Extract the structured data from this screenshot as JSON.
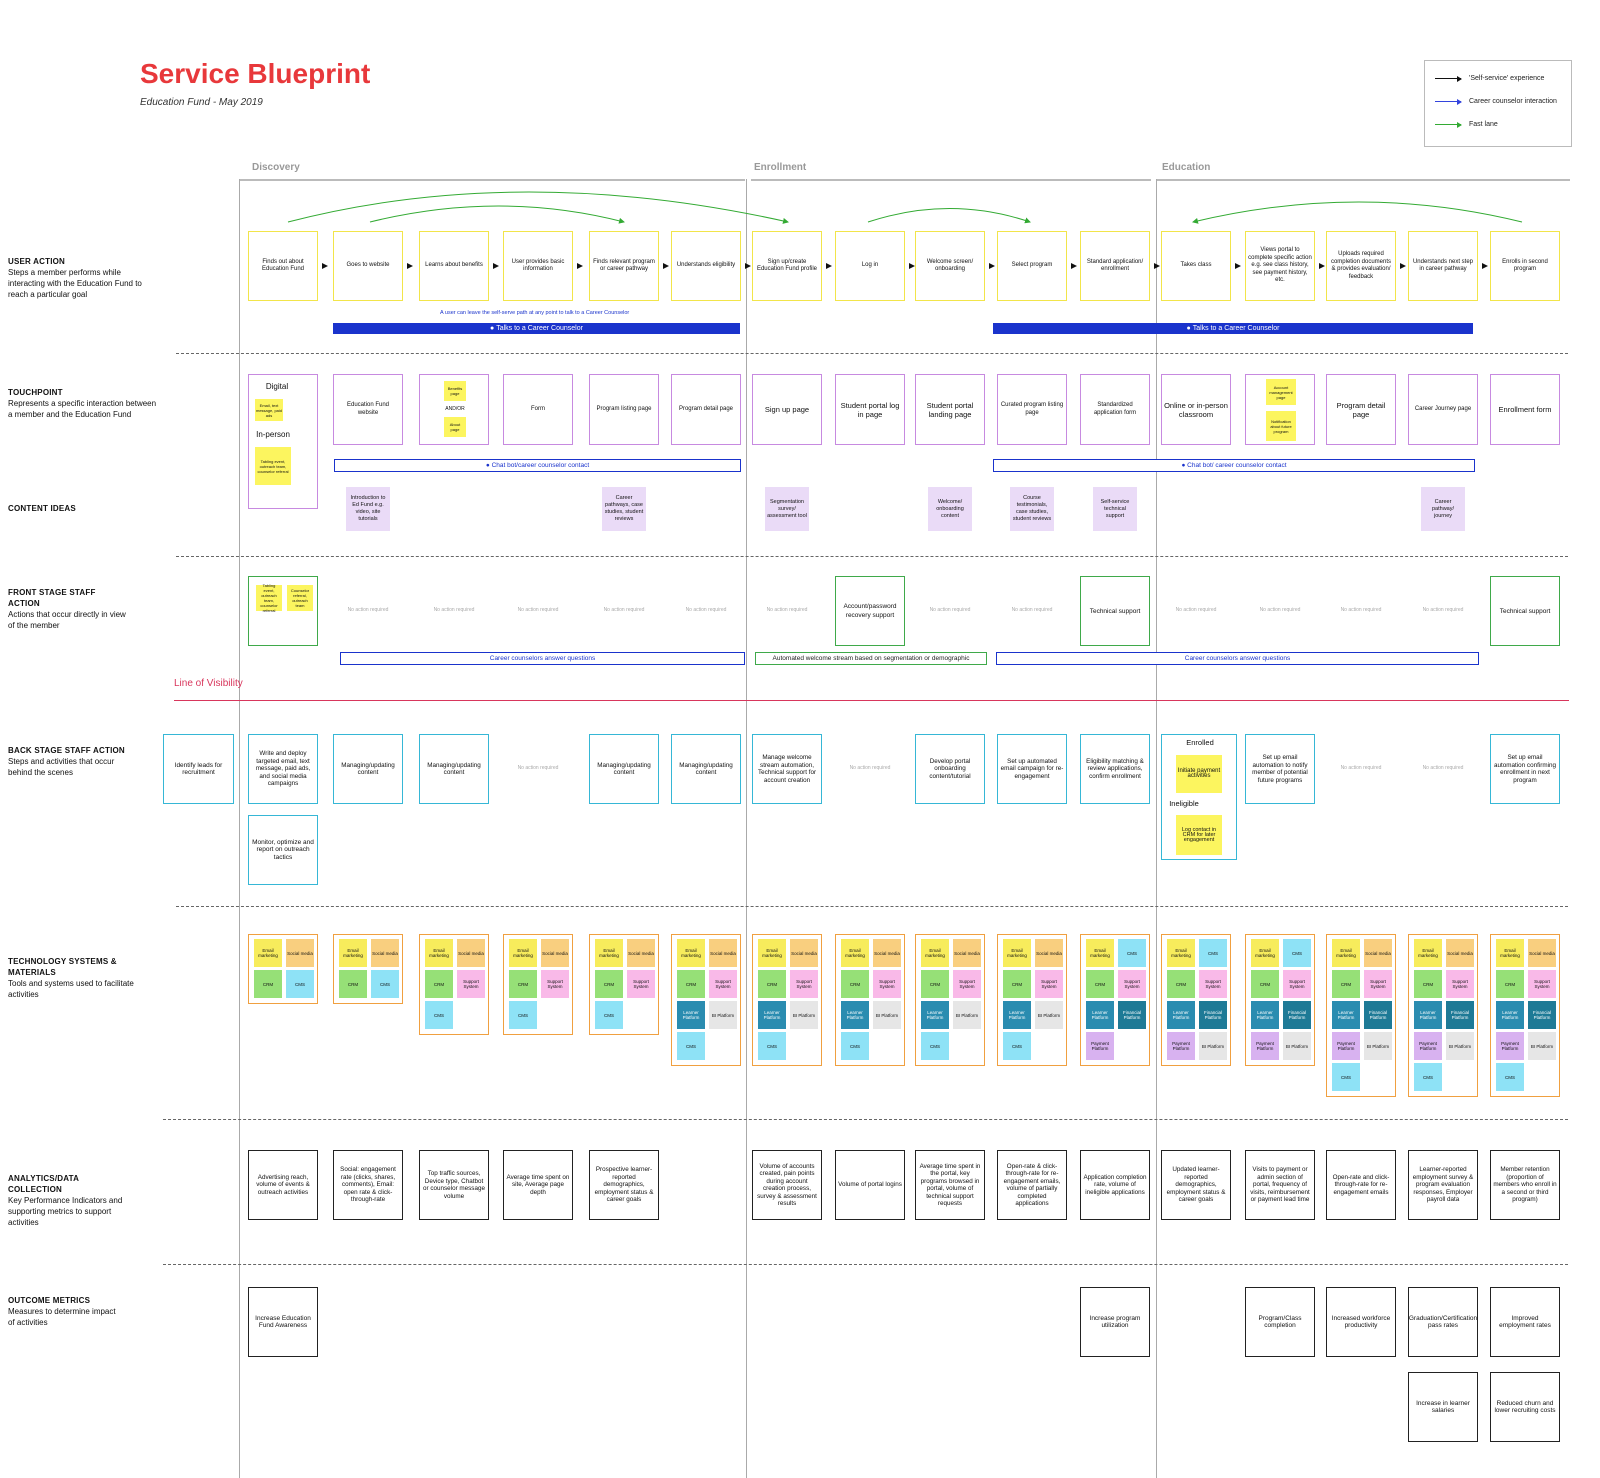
{
  "header": {
    "title": "Service Blueprint",
    "subtitle": "Education Fund - May 2019"
  },
  "legend": [
    {
      "label": "'Self-service' experience",
      "color": "#111111"
    },
    {
      "label": "Career counselor interaction",
      "color": "#3344dd"
    },
    {
      "label": "Fast lane",
      "color": "#33aa33"
    }
  ],
  "phases": [
    "Discovery",
    "Enrollment",
    "Education"
  ],
  "lanes": {
    "user": {
      "title": "USER ACTION",
      "desc": "Steps a member performs while interacting with the Education Fund to reach a particular goal"
    },
    "touch": {
      "title": "TOUCHPOINT",
      "desc": "Represents a specific interaction between a member and the Education Fund"
    },
    "content": {
      "title": "CONTENT IDEAS",
      "desc": ""
    },
    "front": {
      "title": "FRONT STAGE STAFF ACTION",
      "desc": "Actions that occur directly in view of the member"
    },
    "back": {
      "title": "BACK STAGE STAFF ACTION",
      "desc": "Steps and activities that occur behind the scenes"
    },
    "tech": {
      "title": "TECHNOLOGY SYSTEMS & MATERIALS",
      "desc": "Tools and systems used to facilitate activities"
    },
    "analytics": {
      "title": "ANALYTICS/DATA COLLECTION",
      "desc": "Key Performance Indicators and supporting metrics to support activities"
    },
    "outcome": {
      "title": "OUTCOME METRICS",
      "desc": "Measures to determine impact of activities"
    }
  },
  "visibility_label": "Line of Visibility",
  "user_actions": [
    "Finds out about Education Fund",
    "Goes to website",
    "Learns about benefits",
    "User provides basic information",
    "Finds relevant program or career pathway",
    "Understands eligibility",
    "Sign up/create Education Fund profile",
    "Log in",
    "Welcome screen/ onboarding",
    "Select program",
    "Standard application/ enrollment",
    "Takes class",
    "Views portal to complete specific action e.g. see class history, see payment history, etc.",
    "Uploads required completion documents & provides evaluation/ feedback",
    "Understands next step in career pathway",
    "Enrolls in second program"
  ],
  "user_note": "A user can leave the self-serve path at any point to talk to a Career Counselor",
  "counselor_bar": "Talks to a Career Counselor",
  "touchpoints": [
    "",
    "Education Fund website",
    "",
    "Form",
    "Program listing page",
    "Program detail page",
    "Sign up page",
    "Student portal log in page",
    "Student portal landing page",
    "Curated program listing page",
    "Standardized application form",
    "Online or in-person classroom",
    "",
    "Program detail page",
    "Career Journey page",
    "Enrollment form"
  ],
  "touch_extra": {
    "digital": "Digital",
    "digital_note": "Email, text message, paid ads",
    "inperson": "In-person",
    "inperson_note": "Tabling event, outreach team, counselor referral",
    "benefits": "Benefits page",
    "andor": "AND/OR",
    "about": "About page",
    "account": "Account management page",
    "notify": "Notification about future program"
  },
  "chat_bar": "Chat bot/career counselor contact",
  "chat_bar2": "Chat bot/ career counselor contact",
  "content_ideas": [
    {
      "col": 1,
      "text": "Introduction to Ed Fund e.g. video, site tutorials"
    },
    {
      "col": 4,
      "text": "Career pathways, case studies, student reviews"
    },
    {
      "col": 6,
      "text": "Segmentation survey/ assessment tool"
    },
    {
      "col": 8,
      "text": "Welcome/ onboarding content"
    },
    {
      "col": 9,
      "text": "Course testimonials, case studies, student reviews"
    },
    {
      "col": 10,
      "text": "Self-service technical support"
    },
    {
      "col": 14,
      "text": "Career pathway/ journey"
    }
  ],
  "front_stage": [
    "",
    "No action required",
    "No action required",
    "No action required",
    "No action required",
    "No action required",
    "No action required",
    "Account/password recovery support",
    "No action required",
    "No action required",
    "Technical support",
    "No action required",
    "No action required",
    "No action required",
    "No action required",
    "Technical support"
  ],
  "front_stickies": [
    "Tabling event, outreach team, counselor referral",
    "Counselor referral, outreach team"
  ],
  "front_bars": {
    "a": "Career counselors answer questions",
    "b": "Automated welcome stream based on segmentation or demographic",
    "c": "Career counselors answer questions"
  },
  "back_stage": [
    "Write and deploy targeted email, text message, paid ads, and social media campaigns",
    "Managing/updating content",
    "Managing/updating content",
    "No action required",
    "Managing/updating content",
    "Managing/updating content",
    "Manage welcome stream automation, Technical support for account creation",
    "No action required",
    "Develop portal onboarding content/tutorial",
    "Set up automated email campaign for re-engagement",
    "Eligibility matching & review applications, confirm enrollment",
    "",
    "Set up email automation to notify member of potential future programs",
    "No action required",
    "No action required",
    "Set up email automation confirming enrollment in next program"
  ],
  "back_extra": {
    "leads": "Identify leads for recruitment",
    "monitor": "Monitor, optimize and report on outreach tactics",
    "enrolled": "Enrolled",
    "initiate": "Initiate payment activities",
    "ineligible": "Ineligible",
    "log": "Log contact in CRM for later engagement"
  },
  "tech_colors": {
    "Email marketing": "#f7ec5c",
    "Social media": "#f9cf7f",
    "CRM": "#96e077",
    "CMS": "#8ee2f6",
    "Support System": "#f9b9e8",
    "Learner Platform": "#2a8cb0",
    "BI Platform": "#e6e6e6",
    "Financial Platform": "#1e7a96",
    "Payment Platform": "#d8b2f0"
  },
  "tech_columns": [
    [
      [
        "Email marketing",
        "Social media"
      ],
      [
        "CRM",
        "CMS"
      ]
    ],
    [
      [
        "Email marketing",
        "Social media"
      ],
      [
        "CRM",
        "CMS"
      ]
    ],
    [
      [
        "Email marketing",
        "Social media"
      ],
      [
        "CRM",
        "Support System"
      ],
      [
        "CMS"
      ]
    ],
    [
      [
        "Email marketing",
        "Social media"
      ],
      [
        "CRM",
        "Support System"
      ],
      [
        "CMS"
      ]
    ],
    [
      [
        "Email marketing",
        "Social media"
      ],
      [
        "CRM",
        "Support System"
      ],
      [
        "CMS"
      ]
    ],
    [
      [
        "Email marketing",
        "Social media"
      ],
      [
        "CRM",
        "Support System"
      ],
      [
        "Learner Platform",
        "BI Platform"
      ],
      [
        "CMS"
      ]
    ],
    [
      [
        "Email marketing",
        "Social media"
      ],
      [
        "CRM",
        "Support System"
      ],
      [
        "Learner Platform",
        "BI Platform"
      ],
      [
        "CMS"
      ]
    ],
    [
      [
        "Email marketing",
        "Social media"
      ],
      [
        "CRM",
        "Support System"
      ],
      [
        "Learner Platform",
        "BI Platform"
      ],
      [
        "CMS"
      ]
    ],
    [
      [
        "Email marketing",
        "Social media"
      ],
      [
        "CRM",
        "Support System"
      ],
      [
        "Learner Platform",
        "BI Platform"
      ],
      [
        "CMS"
      ]
    ],
    [
      [
        "Email marketing",
        "Social media"
      ],
      [
        "CRM",
        "Support System"
      ],
      [
        "Learner Platform",
        "BI Platform"
      ],
      [
        "CMS"
      ]
    ],
    [
      [
        "Email marketing",
        "CMS"
      ],
      [
        "CRM",
        "Support System"
      ],
      [
        "Learner Platform",
        "Financial Platform"
      ],
      [
        "Payment Platform"
      ]
    ],
    [
      [
        "Email marketing",
        "CMS"
      ],
      [
        "CRM",
        "Support System"
      ],
      [
        "Learner Platform",
        "Financial Platform"
      ],
      [
        "Payment Platform",
        "BI Platform"
      ]
    ],
    [
      [
        "Email marketing",
        "CMS"
      ],
      [
        "CRM",
        "Support System"
      ],
      [
        "Learner Platform",
        "Financial Platform"
      ],
      [
        "Payment Platform",
        "BI Platform"
      ]
    ],
    [
      [
        "Email marketing",
        "Social media"
      ],
      [
        "CRM",
        "Support System"
      ],
      [
        "Learner Platform",
        "Financial Platform"
      ],
      [
        "Payment Platform",
        "BI Platform"
      ],
      [
        "CMS"
      ]
    ],
    [
      [
        "Email marketing",
        "Social media"
      ],
      [
        "CRM",
        "Support System"
      ],
      [
        "Learner Platform",
        "Financial Platform"
      ],
      [
        "Payment Platform",
        "BI Platform"
      ],
      [
        "CMS"
      ]
    ],
    [
      [
        "Email marketing",
        "Social media"
      ],
      [
        "CRM",
        "Support System"
      ],
      [
        "Learner Platform",
        "Financial Platform"
      ],
      [
        "Payment Platform",
        "BI Platform"
      ],
      [
        "CMS"
      ]
    ]
  ],
  "analytics": [
    "Advertising reach, volume of events & outreach activities",
    "Social: engagement rate (clicks, shares, comments), Email: open rate & click-through-rate",
    "Top traffic sources, Device type, Chatbot or counselor message volume",
    "Average time spent on site, Average page depth",
    "Prospective learner-reported demographics, employment status & career goals",
    "",
    "Volume of accounts created, pain points during account creation process, survey & assessment results",
    "Volume of portal logins",
    "Average time spent in the portal, key programs browsed in portal, volume of technical support requests",
    "Open-rate & click-through-rate for re-engagement emails, volume of partially completed applications",
    "Application completion rate, volume of ineligible applications",
    "Updated learner-reported demographics, employment status & career goals",
    "Visits to payment or admin section of portal, frequency of visits, reimbursement or payment lead time",
    "Open-rate and click-through-rate for re-engagement emails",
    "Learner-reported employment survey & program evaluation responses, Employer payroll data",
    "Member retention (proportion of members who enroll in a second or third program)"
  ],
  "outcomes": [
    {
      "col": 0,
      "row": 0,
      "text": "Increase Education Fund Awareness"
    },
    {
      "col": 10,
      "row": 0,
      "text": "Increase program utilization"
    },
    {
      "col": 12,
      "row": 0,
      "text": "Program/Class completion"
    },
    {
      "col": 13,
      "row": 0,
      "text": "Increased workforce productivity"
    },
    {
      "col": 14,
      "row": 0,
      "text": "Graduation/Certification pass rates"
    },
    {
      "col": 15,
      "row": 0,
      "text": "Improved employment rates"
    },
    {
      "col": 14,
      "row": 1,
      "text": "Increase in learner salaries"
    },
    {
      "col": 15,
      "row": 1,
      "text": "Reduced churn and lower recruiting costs"
    }
  ]
}
